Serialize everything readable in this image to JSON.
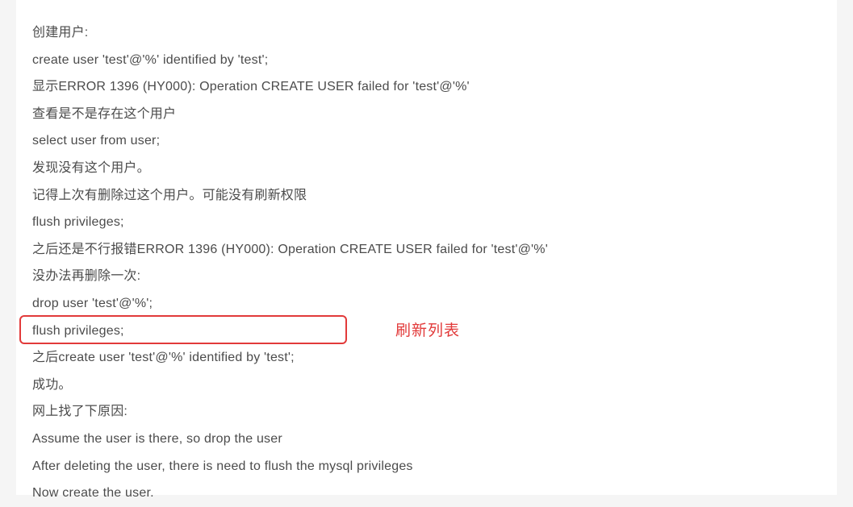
{
  "lines": {
    "l0": "创建用户:",
    "l1": "create user 'test'@'%' identified by 'test';",
    "l2": "显示ERROR 1396 (HY000): Operation CREATE USER failed for 'test'@'%'",
    "l3": "查看是不是存在这个用户",
    "l4": "select user from user;",
    "l5": "发现没有这个用户。",
    "l6": "记得上次有删除过这个用户。可能没有刷新权限",
    "l7": "flush privileges;",
    "l8": "之后还是不行报错ERROR 1396 (HY000): Operation CREATE USER failed for 'test'@'%'",
    "l9": "没办法再删除一次:",
    "l10": "drop user 'test'@'%';",
    "l11": "flush privileges;",
    "l12": "之后create user 'test'@'%' identified by 'test';",
    "l13": "成功。",
    "l14": "网上找了下原因:",
    "l15": "Assume the user is there, so drop the user",
    "l16": "After deleting the user, there is need to flush the mysql privileges",
    "l17": "Now create the user."
  },
  "annotation": "刷新列表"
}
